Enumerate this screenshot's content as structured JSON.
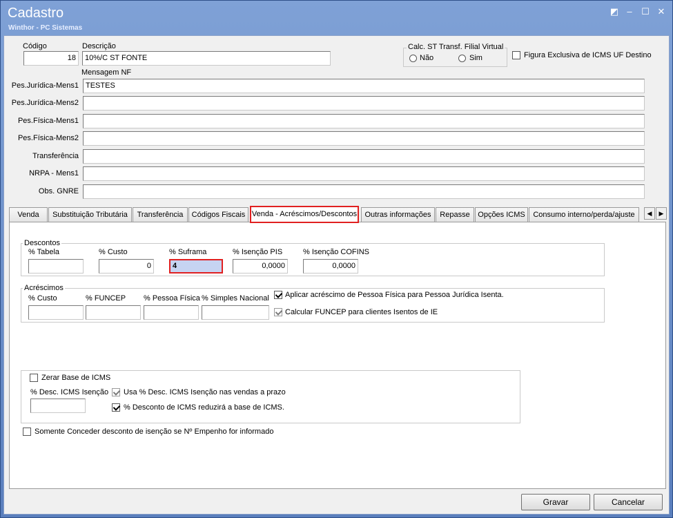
{
  "window": {
    "title": "Cadastro",
    "subtitle": "Winthor - PC Sistemas",
    "controls": [
      "◩",
      "–",
      "☐",
      "✕"
    ]
  },
  "header": {
    "codigo_label": "Código",
    "codigo_value": "18",
    "descricao_label": "Descrição",
    "descricao_value": "10%/C ST FONTE",
    "calc_st_label": "Calc. ST Transf. Filial Virtual",
    "calc_st_options": [
      "Não",
      "Sim"
    ],
    "figura_exclusiva_label": "Figura Exclusiva de ICMS UF Destino",
    "mensagem_label": "Mensagem NF"
  },
  "messages": [
    {
      "label": "Pes.Jurídica-Mens1",
      "value": "TESTES"
    },
    {
      "label": "Pes.Jurídica-Mens2",
      "value": ""
    },
    {
      "label": "Pes.Física-Mens1",
      "value": ""
    },
    {
      "label": "Pes.Física-Mens2",
      "value": ""
    },
    {
      "label": "Transferência",
      "value": ""
    },
    {
      "label": "NRPA - Mens1",
      "value": ""
    },
    {
      "label": "Obs. GNRE",
      "value": ""
    }
  ],
  "tabs": [
    "Venda",
    "Substituição Tributária",
    "Transferência",
    "Códigos Fiscais",
    "Venda - Acréscimos/Descontos",
    "Outras informações",
    "Repasse",
    "Opções ICMS",
    "Consumo interno/perda/ajuste"
  ],
  "descontos": {
    "title": "Descontos",
    "fields": [
      {
        "label": "% Tabela",
        "value": ""
      },
      {
        "label": "% Custo",
        "value": "0"
      },
      {
        "label": "% Suframa",
        "value": "4"
      },
      {
        "label": "% Isenção PIS",
        "value": "0,0000"
      },
      {
        "label": "% Isenção COFINS",
        "value": "0,0000"
      }
    ]
  },
  "acrescimos": {
    "title": "Acréscimos",
    "fields": [
      {
        "label": "% Custo",
        "value": ""
      },
      {
        "label": "% FUNCEP",
        "value": ""
      },
      {
        "label": "% Pessoa Física",
        "value": ""
      },
      {
        "label": "% Simples Nacional",
        "value": ""
      }
    ],
    "aplicar_label": "Aplicar acréscimo de Pessoa Física para Pessoa Jurídica Isenta.",
    "calcular_label": "Calcular FUNCEP para clientes Isentos de IE"
  },
  "icms": {
    "zerar_label": "Zerar Base de ICMS",
    "desc_isencao_label": "% Desc. ICMS Isenção",
    "desc_isencao_value": "",
    "usa_label": "Usa % Desc. ICMS Isenção nas vendas a prazo",
    "reduzira_label": "% Desconto de ICMS reduzirá a base de ICMS."
  },
  "empenho_label": "Somente Conceder desconto de isenção se Nº Empenho for informado",
  "footer": {
    "gravar_label": "Gravar",
    "cancelar_label": "Cancelar"
  },
  "colors": {
    "title_bar": "#6e8fc4",
    "highlight": "#e02020",
    "focused_input": "#c6d4f2"
  }
}
